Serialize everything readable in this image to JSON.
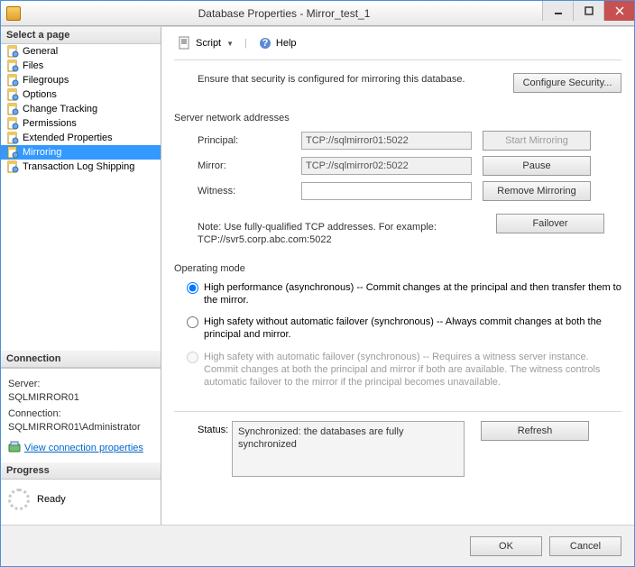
{
  "window": {
    "title": "Database Properties - Mirror_test_1"
  },
  "sidebar": {
    "heading": "Select a page",
    "items": [
      {
        "label": "General"
      },
      {
        "label": "Files"
      },
      {
        "label": "Filegroups"
      },
      {
        "label": "Options"
      },
      {
        "label": "Change Tracking"
      },
      {
        "label": "Permissions"
      },
      {
        "label": "Extended Properties"
      },
      {
        "label": "Mirroring"
      },
      {
        "label": "Transaction Log Shipping"
      }
    ],
    "selected_index": 7
  },
  "connection": {
    "heading": "Connection",
    "server_label": "Server:",
    "server_value": "SQLMIRROR01",
    "connection_label": "Connection:",
    "connection_value": "SQLMIRROR01\\Administrator",
    "view_props_link": "View connection properties"
  },
  "progress": {
    "heading": "Progress",
    "status": "Ready"
  },
  "toolbar": {
    "script_label": "Script",
    "help_label": "Help"
  },
  "main": {
    "security_text": "Ensure that security is configured for mirroring this database.",
    "configure_security_btn": "Configure Security...",
    "addresses_heading": "Server network addresses",
    "principal_label": "Principal:",
    "principal_value": "TCP://sqlmirror01:5022",
    "mirror_label": "Mirror:",
    "mirror_value": "TCP://sqlmirror02:5022",
    "witness_label": "Witness:",
    "witness_value": "",
    "start_mirroring_btn": "Start Mirroring",
    "pause_btn": "Pause",
    "remove_btn": "Remove Mirroring",
    "failover_btn": "Failover",
    "note_text": "Note: Use fully-qualified TCP addresses. For example: TCP://svr5.corp.abc.com:5022",
    "opmode_heading": "Operating mode",
    "opmode_options": [
      "High performance (asynchronous) -- Commit changes at the principal and then transfer them to the mirror.",
      "High safety without automatic failover (synchronous) -- Always commit changes at both the principal and mirror.",
      "High safety with automatic failover (synchronous) -- Requires a witness server instance. Commit changes at both the principal and mirror if both are available. The witness controls automatic failover to the mirror if the principal becomes unavailable."
    ],
    "status_label": "Status:",
    "status_value": "Synchronized: the databases are fully synchronized",
    "refresh_btn": "Refresh"
  },
  "footer": {
    "ok": "OK",
    "cancel": "Cancel"
  }
}
